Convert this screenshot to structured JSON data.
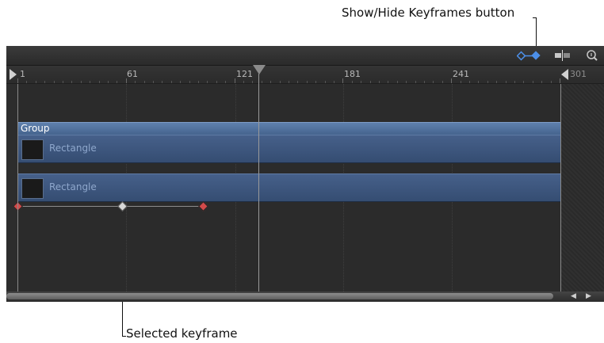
{
  "callouts": {
    "keyframes_button": "Show/Hide Keyframes button",
    "selected_keyframe": "Selected keyframe"
  },
  "ruler": {
    "ticks": [
      "1",
      "61",
      "121",
      "181",
      "241",
      "301"
    ]
  },
  "timeline": {
    "group_label": "Group",
    "layers": [
      {
        "label": "Rectangle"
      },
      {
        "label": "Rectangle"
      }
    ],
    "playhead_frame": 121
  },
  "toolbar": {
    "buttons": [
      {
        "name": "show-hide-keyframes-icon",
        "color": "#4c8fe8"
      },
      {
        "name": "split-clip-icon",
        "color": "#c8c8c8"
      },
      {
        "name": "zoom-icon",
        "color": "#c8c8c8"
      }
    ]
  },
  "keyframes": {
    "colors": {
      "normal": "#d24a4a",
      "selected": "#d8d8d8"
    }
  }
}
